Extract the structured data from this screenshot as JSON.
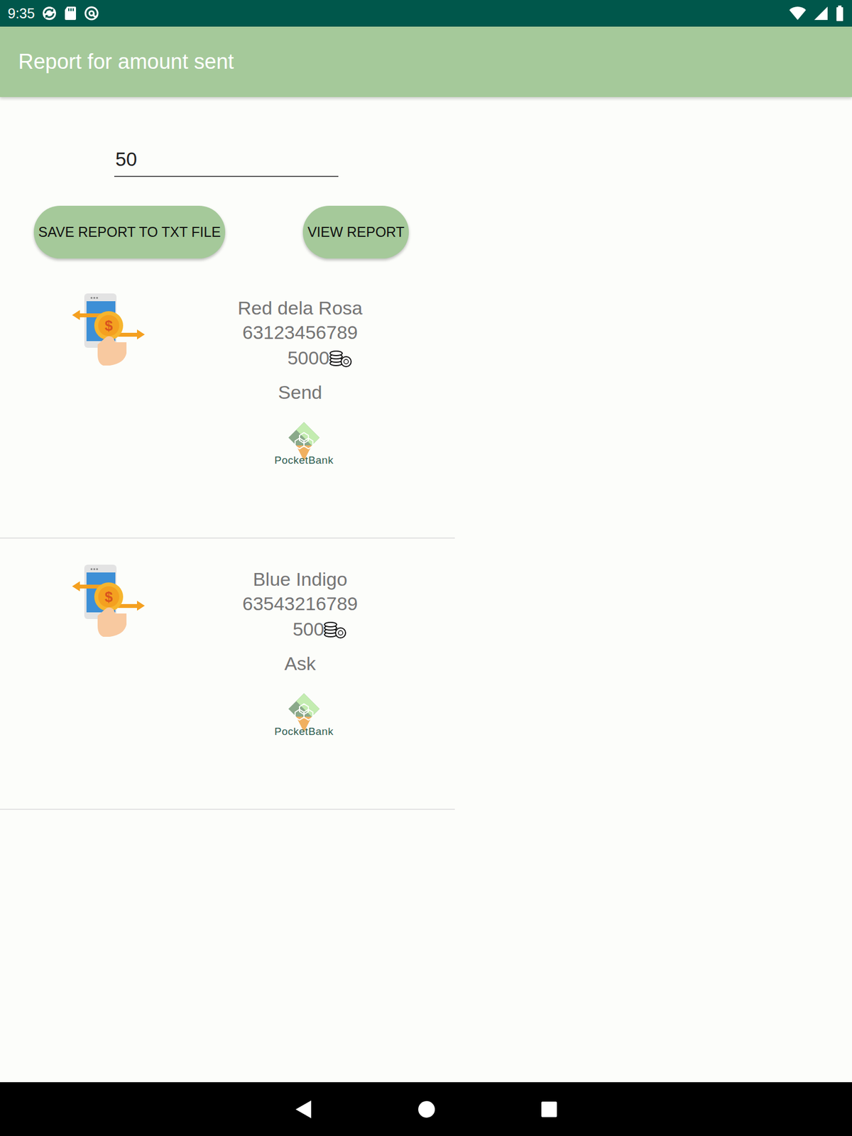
{
  "status_bar": {
    "time": "9:35"
  },
  "app_bar": {
    "title": "Report for amount sent"
  },
  "amount_field": {
    "value": "50"
  },
  "buttons": [
    "SAVE REPORT TO TXT FILE",
    "VIEW REPORT"
  ],
  "transactions": [
    {
      "name": "Red dela Rosa",
      "number": "63123456789",
      "amount": "5000",
      "type": "Send",
      "logo": "PocketBank"
    },
    {
      "name": "Blue Indigo",
      "number": "63543216789",
      "amount": "500",
      "type": "Ask",
      "logo": "PocketBank"
    }
  ]
}
